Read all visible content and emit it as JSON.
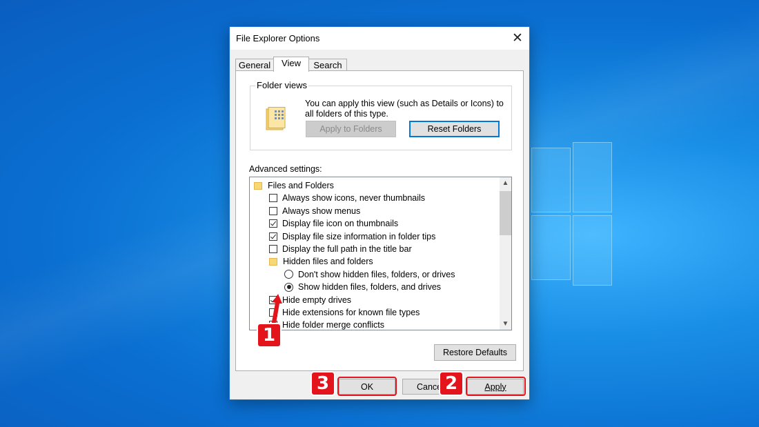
{
  "dialog": {
    "title": "File Explorer Options",
    "close_glyph": "✕"
  },
  "tabs": [
    "General",
    "View",
    "Search"
  ],
  "folder_views": {
    "legend": "Folder views",
    "description": "You can apply this view (such as Details or Icons) to all folders of this type.",
    "apply_button": "Apply to Folders",
    "reset_button": "Reset Folders"
  },
  "advanced": {
    "label": "Advanced settings:",
    "items": [
      {
        "type": "folder",
        "label": "Files and Folders"
      },
      {
        "type": "checkbox",
        "label": "Always show icons, never thumbnails",
        "checked": false
      },
      {
        "type": "checkbox",
        "label": "Always show menus",
        "checked": false
      },
      {
        "type": "checkbox",
        "label": "Display file icon on thumbnails",
        "checked": true
      },
      {
        "type": "checkbox",
        "label": "Display file size information in folder tips",
        "checked": true
      },
      {
        "type": "checkbox",
        "label": "Display the full path in the title bar",
        "checked": false
      },
      {
        "type": "folder",
        "label": "Hidden files and folders"
      },
      {
        "type": "radio",
        "label": "Don't show hidden files, folders, or drives",
        "checked": false
      },
      {
        "type": "radio",
        "label": "Show hidden files, folders, and drives",
        "checked": true
      },
      {
        "type": "checkbox",
        "label": "Hide empty drives",
        "checked": true
      },
      {
        "type": "checkbox",
        "label": "Hide extensions for known file types",
        "checked": false
      },
      {
        "type": "checkbox",
        "label": "Hide folder merge conflicts",
        "checked": false
      }
    ]
  },
  "restore_button": "Restore Defaults",
  "footer": {
    "ok": "OK",
    "cancel": "Cancel",
    "apply": "Apply"
  },
  "badges": [
    "1",
    "2",
    "3"
  ],
  "colors": {
    "highlight": "#e3141b",
    "accent": "#0078d7",
    "desktop": "#0a6fd1"
  }
}
